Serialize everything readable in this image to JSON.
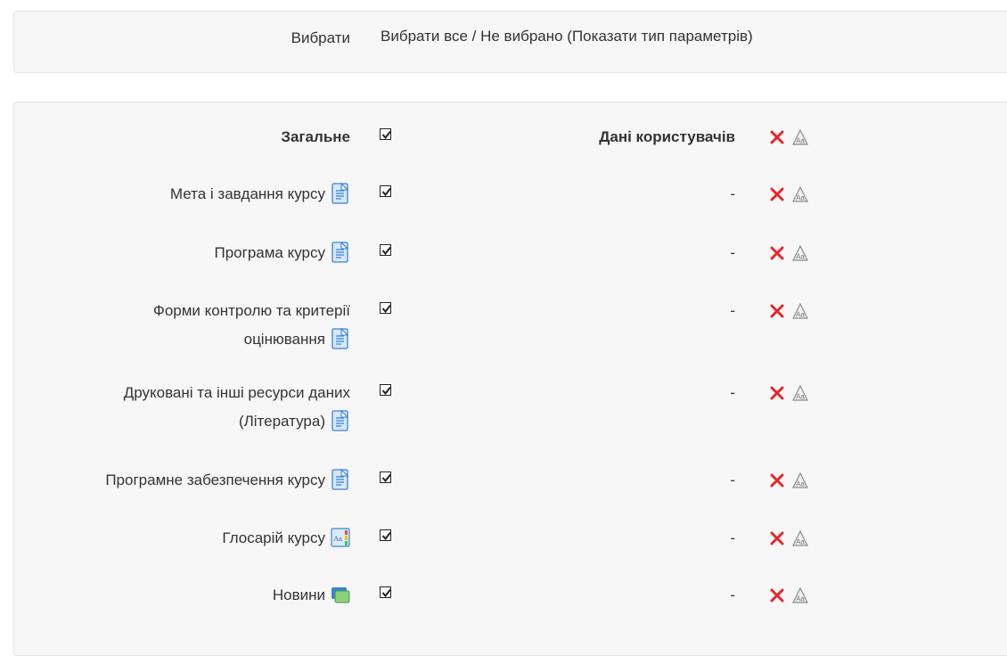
{
  "select": {
    "label": "Вибрати",
    "select_all": "Вибрати все",
    "separator": " / ",
    "select_none": "Не вибрано",
    "show_types": " (Показати тип параметрів)"
  },
  "header_row": {
    "name": "Загальне",
    "user_data": "Дані користувачів"
  },
  "rows": [
    {
      "line1": "Мета і завдання курсу",
      "line2": "",
      "user_data": "-",
      "icon": "page-icon"
    },
    {
      "line1": "Програма курсу",
      "line2": "",
      "user_data": "-",
      "icon": "page-icon"
    },
    {
      "line1": "Форми контролю та критерії",
      "line2": "оцінювання",
      "user_data": "-",
      "icon": "page-icon"
    },
    {
      "line1": "Друковані та інші ресурси даних",
      "line2": "(Література)",
      "user_data": "-",
      "icon": "page-icon"
    },
    {
      "line1": "Програмне забезпечення курсу",
      "line2": "",
      "user_data": "-",
      "icon": "page-icon"
    },
    {
      "line1": "Глосарій курсу",
      "line2": "",
      "user_data": "-",
      "icon": "glossary-icon"
    },
    {
      "line1": "Новини",
      "line2": "",
      "user_data": "-",
      "icon": "forum-icon"
    }
  ],
  "colors": {
    "delete": "#e8252b",
    "checkbox": "#222222",
    "page_icon": "#4a90d9"
  }
}
